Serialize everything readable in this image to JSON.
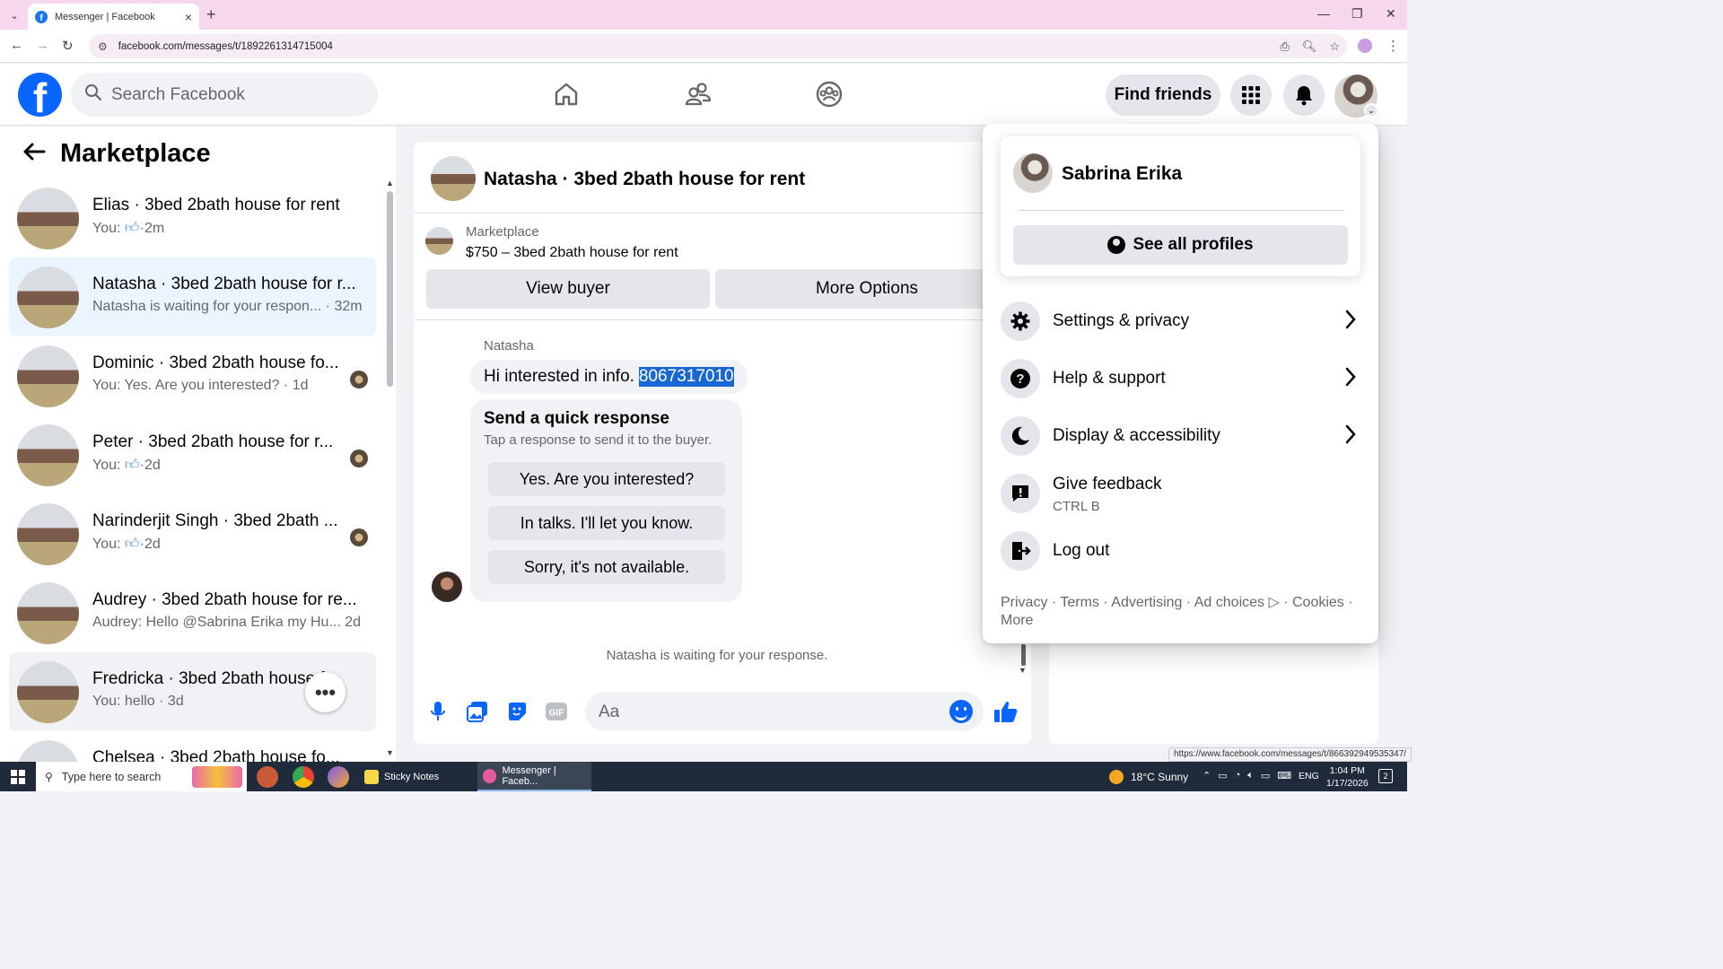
{
  "browser": {
    "tab_title": "Messenger | Facebook",
    "url": "facebook.com/messages/t/1892261314715004",
    "status_url": "https://www.facebook.com/messages/t/866392949535347/"
  },
  "header": {
    "search_placeholder": "Search Facebook",
    "find_friends": "Find friends"
  },
  "left_panel": {
    "title": "Marketplace",
    "conversations": [
      {
        "name": "Elias · 3bed 2bath house for rent",
        "preview": "You:",
        "liked": true,
        "time": "2m"
      },
      {
        "name": "Natasha · 3bed 2bath house for r...",
        "preview": "Natasha is waiting for your respon...",
        "time": "32m"
      },
      {
        "name": "Dominic · 3bed 2bath house fo...",
        "preview": "You: Yes. Are you interested?",
        "time": "1d"
      },
      {
        "name": "Peter · 3bed 2bath house for r...",
        "preview": "You:",
        "liked": true,
        "time": "2d"
      },
      {
        "name": "Narinderjit Singh · 3bed 2bath ...",
        "preview": "You:",
        "liked": true,
        "time": "2d"
      },
      {
        "name": "Audrey · 3bed 2bath house for re...",
        "preview": "Audrey: Hello @Sabrina Erika my Hu...",
        "time": "2d"
      },
      {
        "name": "Fredricka · 3bed 2bath house f...",
        "preview": "You: hello",
        "time": "3d"
      },
      {
        "name": "Chelsea · 3bed 2bath house fo...",
        "preview": "",
        "time": ""
      }
    ]
  },
  "chat": {
    "title": "Natasha · 3bed 2bath house for rent",
    "marketplace_label": "Marketplace",
    "listing": "$750 – 3bed 2bath house for rent",
    "view_buyer": "View buyer",
    "more_options": "More Options",
    "sender": "Natasha",
    "message_text": "Hi interested in info.",
    "message_highlight": "8067317010",
    "quick_title": "Send a quick response",
    "quick_sub": "Tap a response to send it to the buyer.",
    "quick_options": [
      "Yes. Are you interested?",
      "In talks. I'll let you know.",
      "Sorry, it's not available."
    ],
    "waiting": "Natasha is waiting for your response.",
    "composer_placeholder": "Aa",
    "gif_label": "GIF"
  },
  "dropdown": {
    "profile_name": "Sabrina Erika",
    "see_all_profiles": "See all profiles",
    "items": [
      {
        "label": "Settings & privacy",
        "icon": "gear-icon",
        "chevron": true
      },
      {
        "label": "Help & support",
        "icon": "question-icon",
        "chevron": true
      },
      {
        "label": "Display & accessibility",
        "icon": "moon-icon",
        "chevron": true
      },
      {
        "label": "Give feedback",
        "sub": "CTRL B",
        "icon": "feedback-icon",
        "chevron": false
      },
      {
        "label": "Log out",
        "icon": "logout-icon",
        "chevron": false
      }
    ],
    "footer_line1": "Privacy · Terms · Advertising · Ad choices ▷ · Cookies ·",
    "footer_line2": "More"
  },
  "taskbar": {
    "search_placeholder": "Type here to search",
    "sticky_notes": "Sticky Notes",
    "messenger_task": "Messenger | Faceb...",
    "weather": "18°C  Sunny",
    "lang": "ENG",
    "time": "1:04 PM",
    "date": "1/17/2026",
    "notif_count": "2"
  },
  "colors": {
    "brand_blue": "#0866ff",
    "active_row": "#ebf5ff",
    "selection": "#1967d2"
  }
}
